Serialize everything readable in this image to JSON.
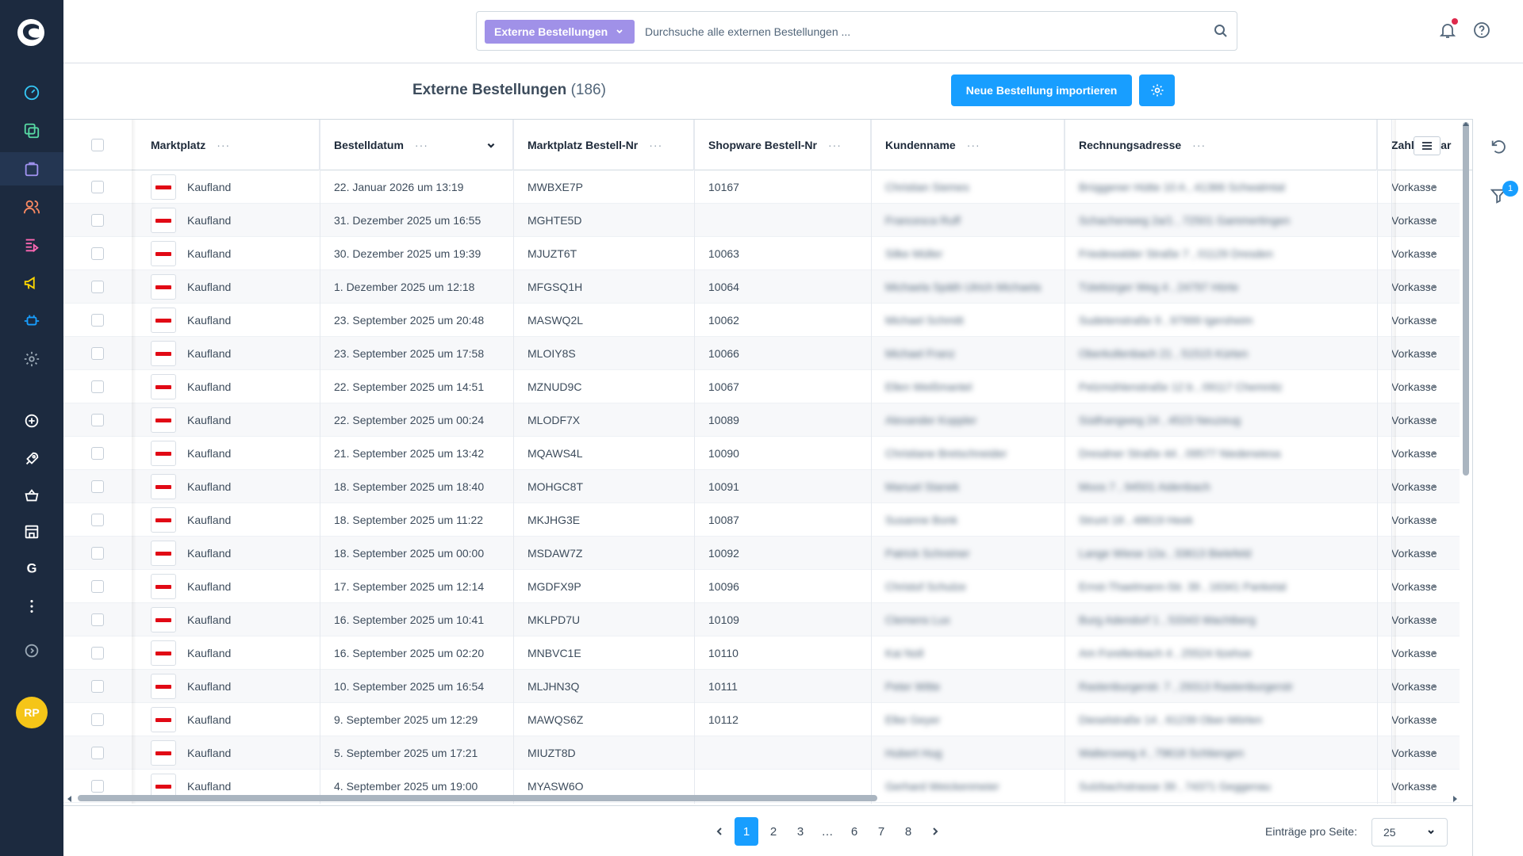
{
  "search": {
    "type_label": "Externe Bestellungen",
    "placeholder": "Durchsuche alle externen Bestellungen ..."
  },
  "page": {
    "title": "Externe Bestellungen",
    "count": "(186)",
    "import_button": "Neue Bestellung importieren"
  },
  "user": {
    "initials": "RP"
  },
  "filter_badge": "1",
  "columns": [
    "Marktplatz",
    "Bestelldatum",
    "Marktplatz Bestell-Nr",
    "Shopware Bestell-Nr",
    "Kundenname",
    "Rechnungsadresse",
    "Zahlungsar"
  ],
  "rows": [
    {
      "marketplace": "Kaufland",
      "date": "22. Januar 2026 um 13:19",
      "mp_no": "MWBXE7P",
      "sw_no": "10167",
      "customer": "Christian Siemes",
      "address": "Brüggener Hütte 10 A , 41366 Schwalmtal",
      "payment": "Vorkasse"
    },
    {
      "marketplace": "Kaufland",
      "date": "31. Dezember 2025 um 16:55",
      "mp_no": "MGHTE5D",
      "sw_no": "",
      "customer": "Francesca Ruff",
      "address": "Schachenweg 2a/1 , 72501 Gammertingen",
      "payment": "Vorkasse"
    },
    {
      "marketplace": "Kaufland",
      "date": "30. Dezember 2025 um 19:39",
      "mp_no": "MJUZT6T",
      "sw_no": "10063",
      "customer": "Silke Müller",
      "address": "Friedewalder Straße 7 , 01129 Dresden",
      "payment": "Vorkasse"
    },
    {
      "marketplace": "Kaufland",
      "date": "1. Dezember 2025 um 12:18",
      "mp_no": "MFGSQ1H",
      "sw_no": "10064",
      "customer": "Michaela Späth Ulrich Michaela",
      "address": "Tütebürger Weg 4 , 24797 Hörte",
      "payment": "Vorkasse"
    },
    {
      "marketplace": "Kaufland",
      "date": "23. September 2025 um 20:48",
      "mp_no": "MASWQ2L",
      "sw_no": "10062",
      "customer": "Michael Schmitt",
      "address": "Sudetenstraße 9 , 97999 Igersheim",
      "payment": "Vorkasse"
    },
    {
      "marketplace": "Kaufland",
      "date": "23. September 2025 um 17:58",
      "mp_no": "MLOIY8S",
      "sw_no": "10066",
      "customer": "Michael Franz",
      "address": "Oberkollenbach 21 , 51515 Kürten",
      "payment": "Vorkasse"
    },
    {
      "marketplace": "Kaufland",
      "date": "22. September 2025 um 14:51",
      "mp_no": "MZNUD9C",
      "sw_no": "10067",
      "customer": "Ellen Weißmantel",
      "address": "Pelzmühlenstraße 12 b , 09117 Chemnitz",
      "payment": "Vorkasse"
    },
    {
      "marketplace": "Kaufland",
      "date": "22. September 2025 um 00:24",
      "mp_no": "MLODF7X",
      "sw_no": "10089",
      "customer": "Alexander Koppler",
      "address": "Südhangweg 24 , 4523 Neuzeug",
      "payment": "Vorkasse"
    },
    {
      "marketplace": "Kaufland",
      "date": "21. September 2025 um 13:42",
      "mp_no": "MQAWS4L",
      "sw_no": "10090",
      "customer": "Christiane Bretschneider",
      "address": "Dresdner Straße 44 , 09577 Niederwiesa",
      "payment": "Vorkasse"
    },
    {
      "marketplace": "Kaufland",
      "date": "18. September 2025 um 18:40",
      "mp_no": "MOHGC8T",
      "sw_no": "10091",
      "customer": "Manuel Stanek",
      "address": "Moos 7 , 94501 Aidenbach",
      "payment": "Vorkasse"
    },
    {
      "marketplace": "Kaufland",
      "date": "18. September 2025 um 11:22",
      "mp_no": "MKJHG3E",
      "sw_no": "10087",
      "customer": "Susanne Bonk",
      "address": "Strunt 18 , 48619 Heek",
      "payment": "Vorkasse"
    },
    {
      "marketplace": "Kaufland",
      "date": "18. September 2025 um 00:00",
      "mp_no": "MSDAW7Z",
      "sw_no": "10092",
      "customer": "Patrick Schreiner",
      "address": "Lange Wiese 12a , 33613 Bielefeld",
      "payment": "Vorkasse"
    },
    {
      "marketplace": "Kaufland",
      "date": "17. September 2025 um 12:14",
      "mp_no": "MGDFX9P",
      "sw_no": "10096",
      "customer": "Christof Schulze",
      "address": "Ernst-Thaelmann-Str. 39 , 16341 Panketal",
      "payment": "Vorkasse"
    },
    {
      "marketplace": "Kaufland",
      "date": "16. September 2025 um 10:41",
      "mp_no": "MKLPD7U",
      "sw_no": "10109",
      "customer": "Clemens Lux",
      "address": "Burg Adendorf 1 , 53343 Wachtberg",
      "payment": "Vorkasse"
    },
    {
      "marketplace": "Kaufland",
      "date": "16. September 2025 um 02:20",
      "mp_no": "MNBVC1E",
      "sw_no": "10110",
      "customer": "Kai Noll",
      "address": "Am Forellenbach 4 , 25524 Itzehoe",
      "payment": "Vorkasse"
    },
    {
      "marketplace": "Kaufland",
      "date": "10. September 2025 um 16:54",
      "mp_no": "MLJHN3Q",
      "sw_no": "10111",
      "customer": "Peter Witte",
      "address": "Rastenburgerstr. 7 , 29313 Rastenburgerstr",
      "payment": "Vorkasse"
    },
    {
      "marketplace": "Kaufland",
      "date": "9. September 2025 um 12:29",
      "mp_no": "MAWQS6Z",
      "sw_no": "10112",
      "customer": "Elke Geyer",
      "address": "Dieselstraße 14 , 61239 Ober-Mörlen",
      "payment": "Vorkasse"
    },
    {
      "marketplace": "Kaufland",
      "date": "5. September 2025 um 17:21",
      "mp_no": "MIUZT8D",
      "sw_no": "",
      "customer": "Hubert Hug",
      "address": "Waltersweg 4 , 79618 Schliengen",
      "payment": "Vorkasse"
    },
    {
      "marketplace": "Kaufland",
      "date": "4. September 2025 um 19:00",
      "mp_no": "MYASW6O",
      "sw_no": "",
      "customer": "Gerhard Weickenmeier",
      "address": "Sulzbachstrasse 39 , 74371 Geggenau",
      "payment": "Vorkasse"
    }
  ],
  "pagination": {
    "pages": [
      "1",
      "2",
      "3",
      "…",
      "6",
      "7",
      "8"
    ],
    "active": "1",
    "per_page_label": "Einträge pro Seite:",
    "per_page_value": "25"
  },
  "colors": {
    "sidebar": "#1c2a3f",
    "primary": "#189eff",
    "search_type": "#a091e8",
    "avatar": "#f5c518",
    "kaufland": "#e10915"
  }
}
